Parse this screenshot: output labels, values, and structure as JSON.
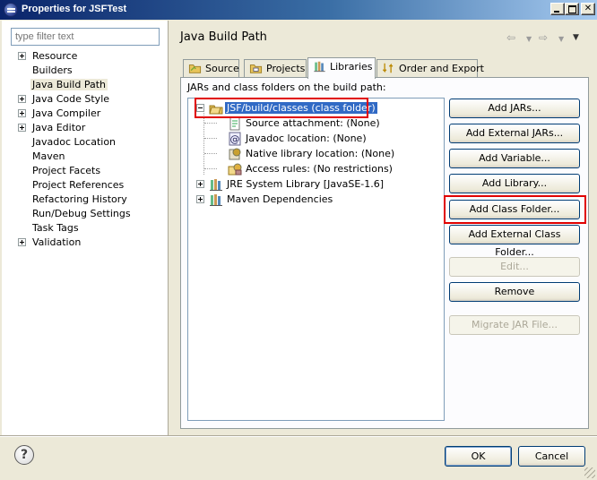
{
  "window": {
    "title": "Properties for JSFTest"
  },
  "filter": {
    "placeholder": "type filter text"
  },
  "nav": {
    "items": [
      {
        "label": "Resource",
        "expandable": true
      },
      {
        "label": "Builders",
        "expandable": false
      },
      {
        "label": "Java Build Path",
        "expandable": false,
        "selected": true
      },
      {
        "label": "Java Code Style",
        "expandable": true
      },
      {
        "label": "Java Compiler",
        "expandable": true
      },
      {
        "label": "Java Editor",
        "expandable": true
      },
      {
        "label": "Javadoc Location",
        "expandable": false
      },
      {
        "label": "Maven",
        "expandable": false
      },
      {
        "label": "Project Facets",
        "expandable": false
      },
      {
        "label": "Project References",
        "expandable": false
      },
      {
        "label": "Refactoring History",
        "expandable": false
      },
      {
        "label": "Run/Debug Settings",
        "expandable": false
      },
      {
        "label": "Task Tags",
        "expandable": false
      },
      {
        "label": "Validation",
        "expandable": true
      }
    ]
  },
  "page": {
    "title": "Java Build Path",
    "tabs": [
      "Source",
      "Projects",
      "Libraries",
      "Order and Export"
    ],
    "active_tab": "Libraries",
    "description": "JARs and class folders on the build path:"
  },
  "tree": {
    "root": "JSF/build/classes (class folder)",
    "children": [
      "Source attachment: (None)",
      "Javadoc location: (None)",
      "Native library location: (None)",
      "Access rules: (No restrictions)"
    ],
    "others": [
      "JRE System Library [JavaSE-1.6]",
      "Maven Dependencies"
    ]
  },
  "buttons": {
    "add_jars": "Add JARs...",
    "add_external_jars": "Add External JARs...",
    "add_variable": "Add Variable...",
    "add_library": "Add Library...",
    "add_class_folder": "Add Class Folder...",
    "add_external_class_folder": "Add External Class Folder...",
    "edit": "Edit...",
    "remove": "Remove",
    "migrate_jar": "Migrate JAR File..."
  },
  "footer": {
    "help": "?",
    "ok": "OK",
    "cancel": "Cancel"
  },
  "colors": {
    "highlight": "#e00000",
    "selection": "#316ac5",
    "title_bar": "#0a246a"
  }
}
